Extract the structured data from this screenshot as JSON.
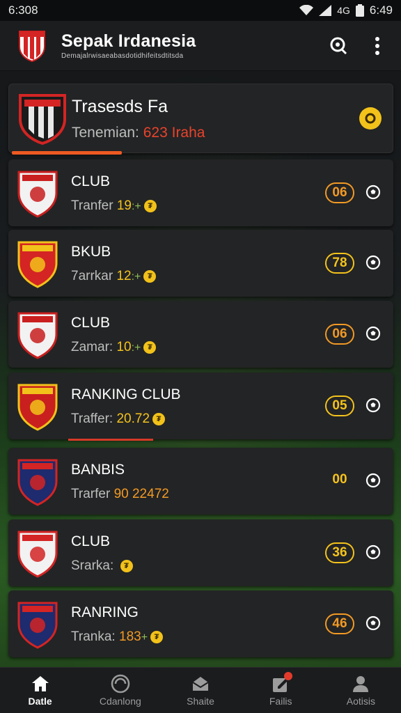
{
  "status_bar": {
    "time_left": "6:308",
    "time_right": "6:49",
    "network": "4G"
  },
  "app_bar": {
    "title": "Sepak Irdanesia",
    "subtitle": "Demajalrwisaeabasdotidhifeitsdtitsda"
  },
  "featured": {
    "name": "Trasesds Fa",
    "label": "Tenemian:",
    "value": "623 Iraha",
    "progress": 0.29
  },
  "clubs": [
    {
      "name": "CLUB",
      "label": "Tranfer",
      "value": "19",
      "arrow": ":+",
      "score": "06",
      "score_style": "orange"
    },
    {
      "name": "BKUB",
      "label": "7arrkar",
      "value": "12",
      "arrow": ":+",
      "score": "78",
      "score_style": "yellow"
    },
    {
      "name": "CLUB",
      "label": "Zamar:",
      "value": "10",
      "arrow": ":+",
      "score": "06",
      "score_style": "orange"
    },
    {
      "name": "RANKING CLUB",
      "label": "Traffer:",
      "value": "20.72",
      "arrow": "",
      "score": "05",
      "score_style": "yellow"
    },
    {
      "name": "BANBIS",
      "label": "Trarfer",
      "value": "90 22472",
      "arrow": "",
      "score": "00",
      "score_style": "plain"
    },
    {
      "name": "CLUB",
      "label": "Srarka:",
      "value": "",
      "arrow": "",
      "score": "36",
      "score_style": "yellow"
    },
    {
      "name": "RANRING",
      "label": "Tranka:",
      "value": "183",
      "arrow": "+",
      "score": "46",
      "score_style": "orange"
    }
  ],
  "coin_symbol": "₮",
  "nav": [
    {
      "label": "Datle",
      "icon": "home-icon"
    },
    {
      "label": "Cdanlong",
      "icon": "ball-icon"
    },
    {
      "label": "Shaite",
      "icon": "mail-icon"
    },
    {
      "label": "Failis",
      "icon": "edit-icon"
    },
    {
      "label": "Aotisis",
      "icon": "person-icon"
    }
  ],
  "colors": {
    "accent": "#f29a25",
    "gold": "#f4c31c",
    "red": "#e9432c"
  }
}
